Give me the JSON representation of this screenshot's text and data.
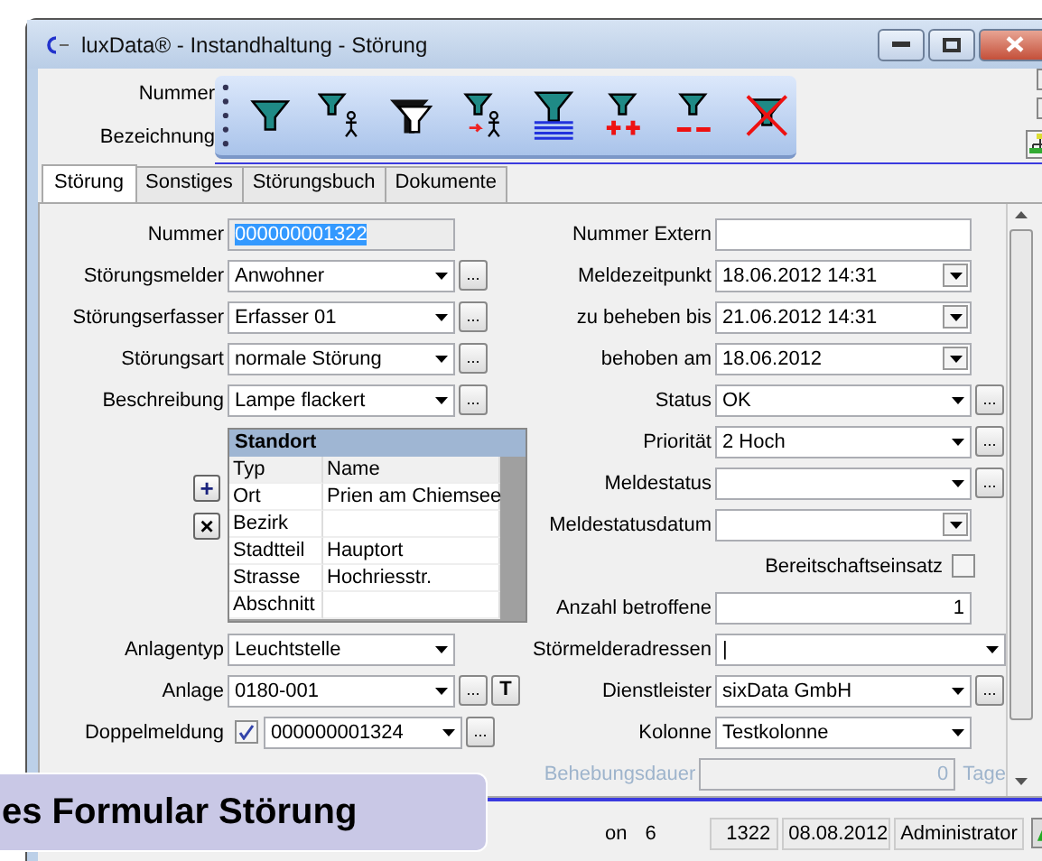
{
  "window": {
    "title": "luxData® - Instandhaltung - Störung"
  },
  "header_labels": [
    "Nummer",
    "Bezeichnung"
  ],
  "tabs": [
    {
      "label": "Störung",
      "selected": true
    },
    {
      "label": "Sonstiges",
      "selected": false
    },
    {
      "label": "Störungsbuch",
      "selected": false
    },
    {
      "label": "Dokumente",
      "selected": false
    }
  ],
  "left_fields": [
    {
      "kind": "text",
      "label": "Nummer",
      "value": "000000001322",
      "value_selected": true,
      "readonly": true
    },
    {
      "kind": "combo",
      "label": "Störungsmelder",
      "value": "Anwohner",
      "button": "..."
    },
    {
      "kind": "combo",
      "label": "Störungserfasser",
      "value": "Erfasser 01",
      "button": "..."
    },
    {
      "kind": "combo",
      "label": "Störungsart",
      "value": "normale Störung",
      "button": "..."
    },
    {
      "kind": "combo",
      "label": "Beschreibung",
      "value": "Lampe flackert",
      "button": "..."
    }
  ],
  "standort": {
    "title": "Standort",
    "add_button": "+",
    "remove_button": "×",
    "columns": [
      "Typ",
      "Name"
    ],
    "rows": [
      {
        "typ": "Ort",
        "name": "Prien am Chiemsee"
      },
      {
        "typ": "Bezirk",
        "name": ""
      },
      {
        "typ": "Stadtteil",
        "name": "Hauptort"
      },
      {
        "typ": "Strasse",
        "name": "Hochriesstr."
      },
      {
        "typ": "Abschnitt",
        "name": ""
      }
    ]
  },
  "left_fields_lower": [
    {
      "kind": "combo",
      "label": "Anlagentyp",
      "value": "Leuchtstelle"
    },
    {
      "kind": "combo",
      "label": "Anlage",
      "value": "0180-001",
      "button": "...",
      "extra_button": "T"
    },
    {
      "kind": "check_combo",
      "label": "Doppelmeldung",
      "checked": true,
      "value": "000000001324",
      "button": "..."
    }
  ],
  "right_fields": [
    {
      "kind": "text",
      "label": "Nummer Extern"
    },
    {
      "kind": "date",
      "label": "Meldezeitpunkt",
      "value": "18.06.2012 14:31"
    },
    {
      "kind": "date",
      "label": "zu beheben bis",
      "value": "21.06.2012 14:31"
    },
    {
      "kind": "date",
      "label": "behoben am",
      "value": "18.06.2012"
    },
    {
      "kind": "combo",
      "label": "Status",
      "value": "OK",
      "button": "..."
    },
    {
      "kind": "combo",
      "label": "Priorität",
      "value": "2 Hoch",
      "button": "..."
    },
    {
      "kind": "combo",
      "label": "Meldestatus",
      "button": "..."
    },
    {
      "kind": "date",
      "label": "Meldestatusdatum"
    },
    {
      "kind": "checkbox",
      "label": "Bereitschaftseinsatz",
      "checked": false
    },
    {
      "kind": "number",
      "label": "Anzahl betroffene",
      "value": "1"
    },
    {
      "kind": "combo",
      "label": "Störmelderadressen",
      "value": "|",
      "wide": true
    },
    {
      "kind": "combo",
      "label": "Dienstleister",
      "value": "sixData GmbH",
      "button": "..."
    },
    {
      "kind": "combo",
      "label": "Kolonne",
      "value": "Testkolonne"
    },
    {
      "kind": "number",
      "label": "Behebungsdauer",
      "value": "0",
      "unit": "Tage",
      "disabled": true
    }
  ],
  "status_bar": [
    "on",
    "6",
    "1322",
    "08.08.2012",
    "Administrator"
  ],
  "caption": "es Formular Störung"
}
